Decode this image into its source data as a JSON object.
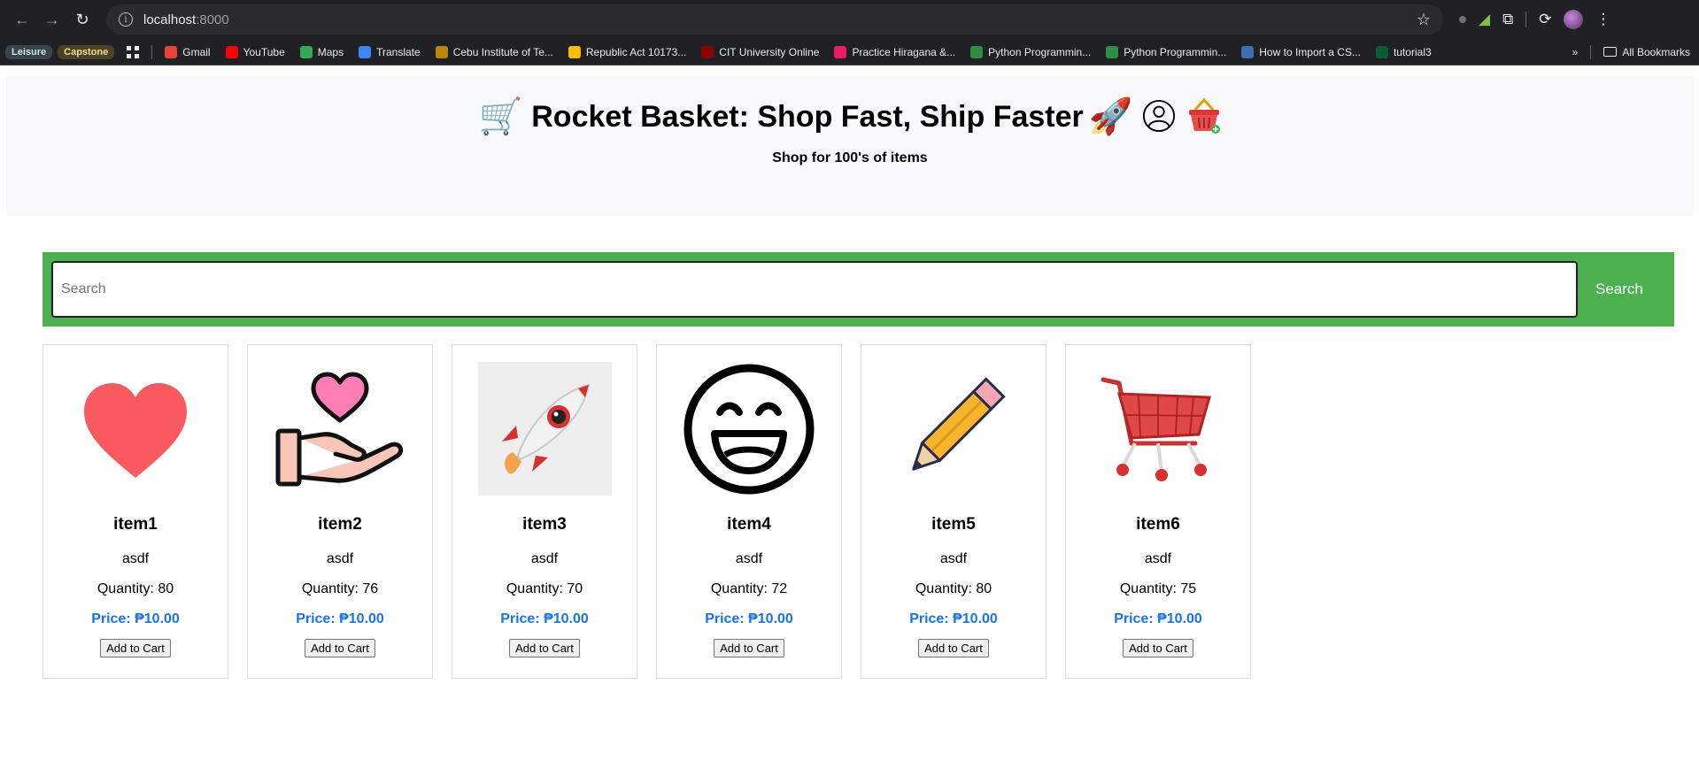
{
  "browser": {
    "url_host": "localhost",
    "url_port": ":8000",
    "bookmarks": {
      "chips": [
        "Leisure",
        "Capstone"
      ],
      "items": [
        {
          "label": "Gmail",
          "color": "#ea4335"
        },
        {
          "label": "YouTube",
          "color": "#ff0000"
        },
        {
          "label": "Maps",
          "color": "#34a853"
        },
        {
          "label": "Translate",
          "color": "#4285f4"
        },
        {
          "label": "Cebu Institute of Te...",
          "color": "#b8860b"
        },
        {
          "label": "Republic Act 10173...",
          "color": "#fbbc04"
        },
        {
          "label": "CIT University Online",
          "color": "#8b0000"
        },
        {
          "label": "Practice Hiragana &...",
          "color": "#e91e63"
        },
        {
          "label": "Python Programmin...",
          "color": "#2f8d46"
        },
        {
          "label": "Python Programmin...",
          "color": "#2f8d46"
        },
        {
          "label": "How to Import a CS...",
          "color": "#3f6db3"
        },
        {
          "label": "tutorial3",
          "color": "#0a5c36"
        }
      ],
      "all_bookmarks": "All Bookmarks"
    }
  },
  "header": {
    "title": "Rocket Basket: Shop Fast, Ship Faster",
    "subtitle": "Shop for 100's of items",
    "cart_emoji": "🛒",
    "rocket_emoji": "🚀",
    "basket_emoji": "🧺"
  },
  "search": {
    "placeholder": "Search",
    "button_label": "Search"
  },
  "products": [
    {
      "name": "item1",
      "description": "asdf",
      "quantity": "Quantity: 80",
      "price": "Price: ₱10.00",
      "button": "Add to Cart",
      "icon": "heart-icon"
    },
    {
      "name": "item2",
      "description": "asdf",
      "quantity": "Quantity: 76",
      "price": "Price: ₱10.00",
      "button": "Add to Cart",
      "icon": "hand-heart-icon"
    },
    {
      "name": "item3",
      "description": "asdf",
      "quantity": "Quantity: 70",
      "price": "Price: ₱10.00",
      "button": "Add to Cart",
      "icon": "rocket-icon"
    },
    {
      "name": "item4",
      "description": "asdf",
      "quantity": "Quantity: 72",
      "price": "Price: ₱10.00",
      "button": "Add to Cart",
      "icon": "smiley-icon"
    },
    {
      "name": "item5",
      "description": "asdf",
      "quantity": "Quantity: 80",
      "price": "Price: ₱10.00",
      "button": "Add to Cart",
      "icon": "pencil-icon"
    },
    {
      "name": "item6",
      "description": "asdf",
      "quantity": "Quantity: 75",
      "price": "Price: ₱10.00",
      "button": "Add to Cart",
      "icon": "shopping-cart-icon"
    }
  ],
  "colors": {
    "accent_green": "#4caf50",
    "price_blue": "#1a73e8"
  }
}
